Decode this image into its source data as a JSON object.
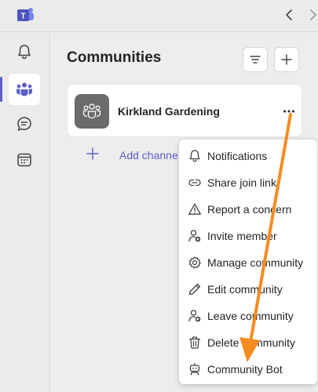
{
  "app": {
    "logo_letter": "T"
  },
  "header": {
    "title": "Communities"
  },
  "rail": {
    "items": [
      {
        "icon": "bell-icon",
        "label": "Activity"
      },
      {
        "icon": "communities-icon",
        "label": "Communities",
        "active": true
      },
      {
        "icon": "chat-icon",
        "label": "Chat"
      },
      {
        "icon": "calendar-icon",
        "label": "Calendar"
      }
    ]
  },
  "community": {
    "name": "Kirkland Gardening",
    "add_channel_label": "Add channe"
  },
  "menu": {
    "items": [
      {
        "label": "Notifications",
        "icon": "bell-icon"
      },
      {
        "label": "Share join link",
        "icon": "link-icon"
      },
      {
        "label": "Report a concern",
        "icon": "warning-icon"
      },
      {
        "label": "Invite member",
        "icon": "person-add-icon"
      },
      {
        "label": "Manage community",
        "icon": "gear-icon"
      },
      {
        "label": "Edit community",
        "icon": "pencil-icon"
      },
      {
        "label": "Leave community",
        "icon": "person-leave-icon"
      },
      {
        "label": "Delete community",
        "icon": "trash-icon"
      },
      {
        "label": "Community Bot",
        "icon": "bot-icon"
      }
    ]
  },
  "colors": {
    "accent": "#5b5fc7",
    "annotation_arrow": "#f68b1f"
  }
}
